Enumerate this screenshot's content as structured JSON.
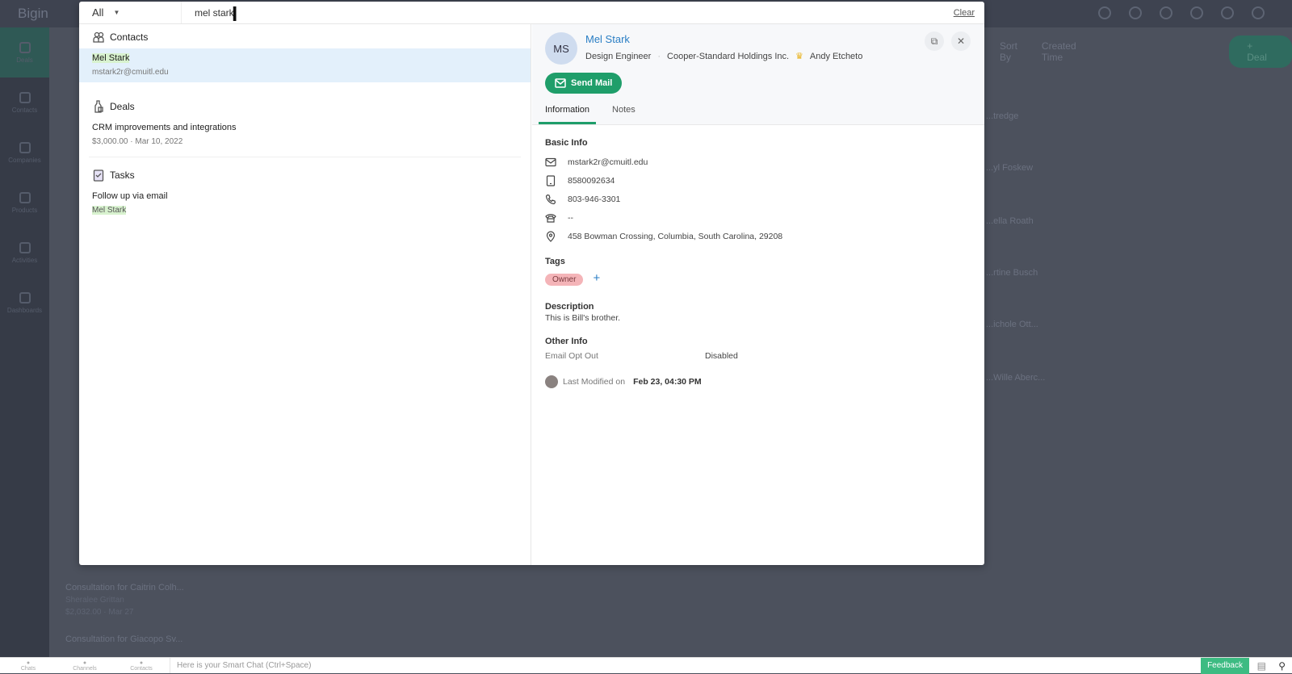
{
  "background": {
    "logo": "Bigin",
    "sidebar": [
      "Deals",
      "Contacts",
      "Companies",
      "Products",
      "Activities",
      "Dashboards"
    ],
    "cards": [
      "Consultation for Caitrin Colh...",
      "Sheralee Grittan",
      "$2,032.00 · Mar 27",
      "Consultation for Giacopo Sv..."
    ],
    "right_names": [
      "...tredge",
      "...yl Foskew",
      "...ella Roath",
      "...rtine Busch",
      "...ichole Ott...",
      "...Wille Aberc..."
    ],
    "sort_label": "Sort By",
    "sort_value": "Created Time",
    "new_deal": "+ Deal"
  },
  "search": {
    "scope": "All",
    "query": "mel stark",
    "clear": "Clear"
  },
  "results": {
    "contacts": {
      "title": "Contacts",
      "items": [
        {
          "name": "Mel Stark",
          "email": "mstark2r@cmuitl.edu"
        }
      ]
    },
    "deals": {
      "title": "Deals",
      "items": [
        {
          "name": "CRM improvements and integrations",
          "meta": "$3,000.00 · Mar 10, 2022"
        }
      ]
    },
    "tasks": {
      "title": "Tasks",
      "items": [
        {
          "name": "Follow up via email",
          "contact": "Mel Stark"
        }
      ]
    }
  },
  "preview": {
    "initials": "MS",
    "name": "Mel Stark",
    "title": "Design Engineer",
    "company": "Cooper-Standard Holdings Inc.",
    "owner": "Andy Etcheto",
    "send_mail": "Send Mail",
    "tabs": [
      "Information",
      "Notes"
    ],
    "basic_info": {
      "heading": "Basic Info",
      "email": "mstark2r@cmuitl.edu",
      "mobile": "8580092634",
      "phone": "803-946-3301",
      "home_phone": "--",
      "address": "458 Bowman Crossing, Columbia, South Carolina, 29208"
    },
    "tags": {
      "heading": "Tags",
      "items": [
        "Owner"
      ],
      "add": "+"
    },
    "description": {
      "heading": "Description",
      "text": "This is Bill's brother."
    },
    "other_info": {
      "heading": "Other Info",
      "label": "Email Opt Out",
      "value": "Disabled"
    },
    "last_modified": {
      "label": "Last Modified on",
      "value": "Feb 23, 04:30 PM"
    }
  },
  "bottom_bar": {
    "buttons": [
      "Chats",
      "Channels",
      "Contacts"
    ],
    "chat_placeholder": "Here is your Smart Chat (Ctrl+Space)",
    "feedback": "Feedback"
  },
  "colors": {
    "accent": "#1f9e6a",
    "link": "#2a7ec4",
    "highlight": "#e3f0fb",
    "tag": "#f4b4b8"
  }
}
